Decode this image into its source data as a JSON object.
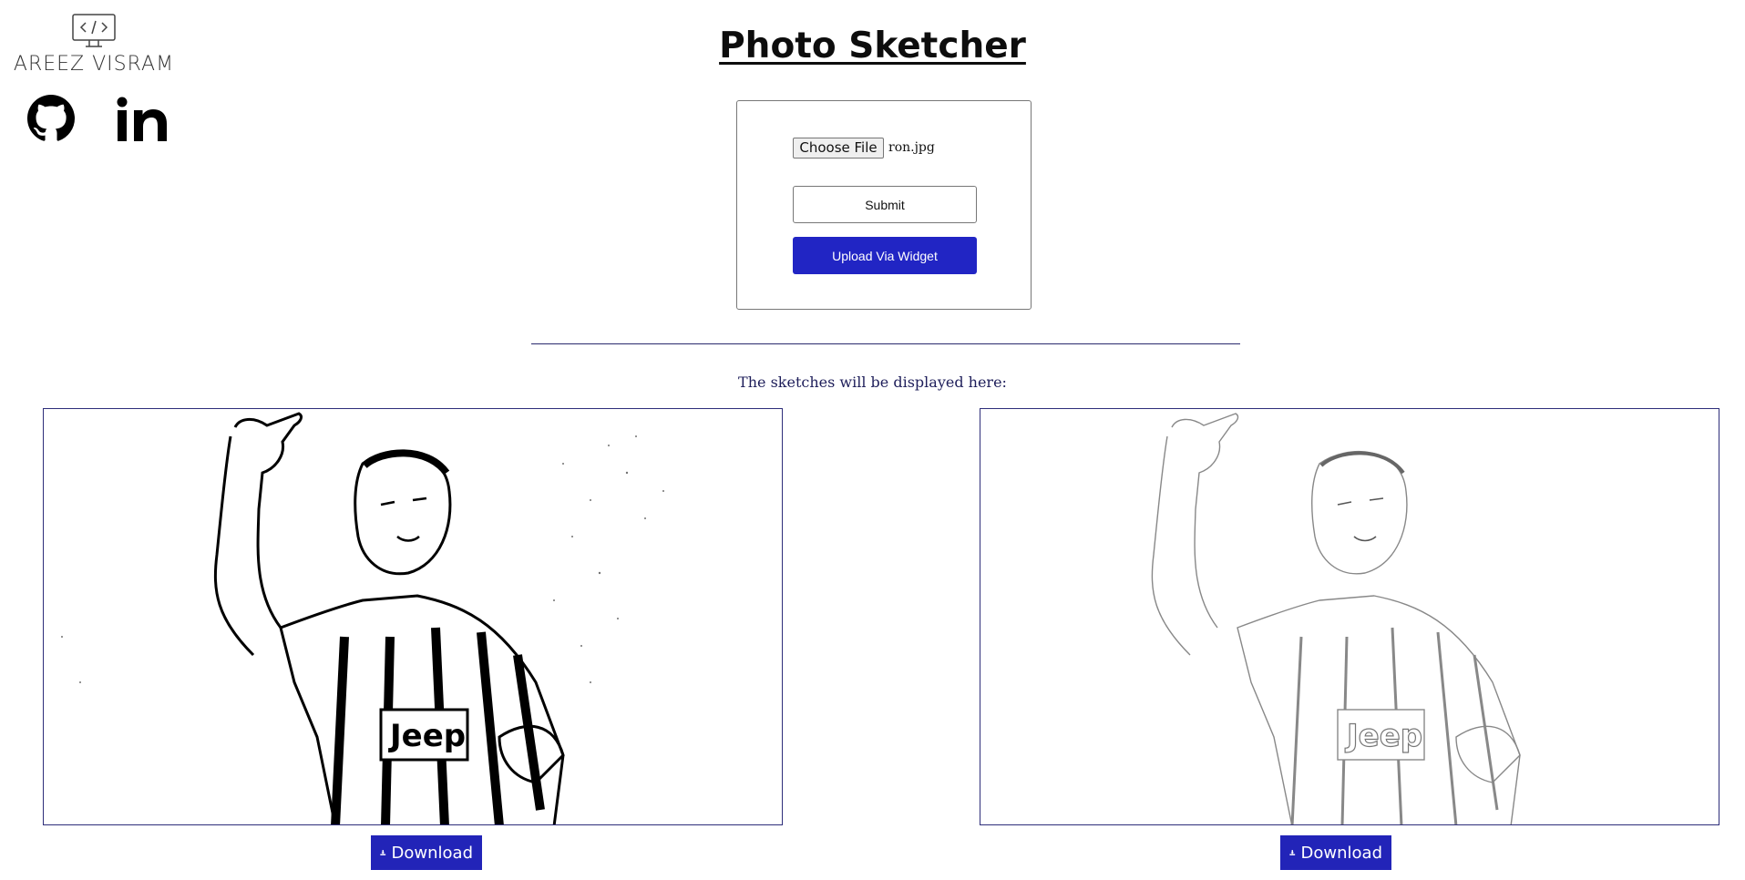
{
  "brand": {
    "name": "AREEZ VISRAM",
    "logo_icon": "code-monitor-icon"
  },
  "social": [
    {
      "name": "github-icon"
    },
    {
      "name": "linkedin-icon"
    }
  ],
  "page": {
    "title": "Photo Sketcher"
  },
  "form": {
    "choose_file_label": "Choose File",
    "file_name": "ron.jpg",
    "submit_label": "Submit",
    "widget_label": "Upload Via Widget"
  },
  "results": {
    "caption": "The sketches will be displayed here:",
    "download_label": "Download",
    "sketch_left_alt": "sketch-dark",
    "sketch_right_alt": "sketch-light"
  },
  "colors": {
    "accent": "#2125c4",
    "border": "#2e2e7a"
  }
}
